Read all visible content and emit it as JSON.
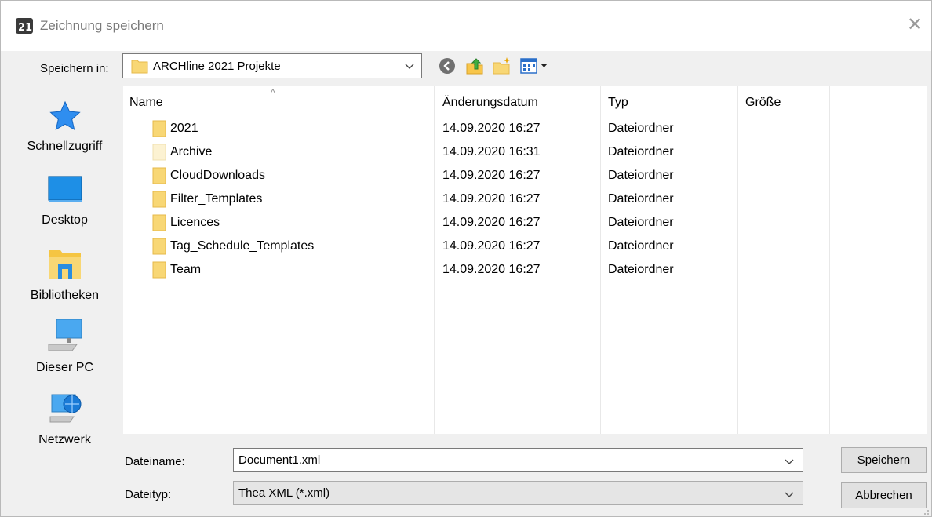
{
  "window": {
    "title": "Zeichnung speichern",
    "close_glyph": "✕"
  },
  "location": {
    "label": "Speichern in:",
    "value": "ARCHline 2021 Projekte"
  },
  "toolbar": {
    "icons": [
      "back-icon",
      "up-folder-icon",
      "new-folder-icon",
      "view-menu-icon"
    ]
  },
  "places": [
    {
      "label": "Schnellzugriff",
      "icon": "star-icon"
    },
    {
      "label": "Desktop",
      "icon": "desktop-icon"
    },
    {
      "label": "Bibliotheken",
      "icon": "libraries-icon"
    },
    {
      "label": "Dieser PC",
      "icon": "computer-icon"
    },
    {
      "label": "Netzwerk",
      "icon": "network-icon"
    }
  ],
  "columns": {
    "name": "Name",
    "date": "Änderungsdatum",
    "type": "Typ",
    "size": "Größe"
  },
  "files": [
    {
      "name": "2021",
      "date": "14.09.2020 16:27",
      "type": "Dateiordner"
    },
    {
      "name": "Archive",
      "date": "14.09.2020 16:31",
      "type": "Dateiordner"
    },
    {
      "name": "CloudDownloads",
      "date": "14.09.2020 16:27",
      "type": "Dateiordner"
    },
    {
      "name": "Filter_Templates",
      "date": "14.09.2020 16:27",
      "type": "Dateiordner"
    },
    {
      "name": "Licences",
      "date": "14.09.2020 16:27",
      "type": "Dateiordner"
    },
    {
      "name": "Tag_Schedule_Templates",
      "date": "14.09.2020 16:27",
      "type": "Dateiordner"
    },
    {
      "name": "Team",
      "date": "14.09.2020 16:27",
      "type": "Dateiordner"
    }
  ],
  "filename": {
    "label": "Dateiname:",
    "value": "Document1.xml"
  },
  "filetype": {
    "label": "Dateityp:",
    "value": "Thea XML (*.xml)"
  },
  "buttons": {
    "save": "Speichern",
    "cancel": "Abbrechen"
  },
  "colors": {
    "folder": "#f8d775",
    "folder_dark": "#e6b94a",
    "accent_blue": "#1e90ff"
  }
}
